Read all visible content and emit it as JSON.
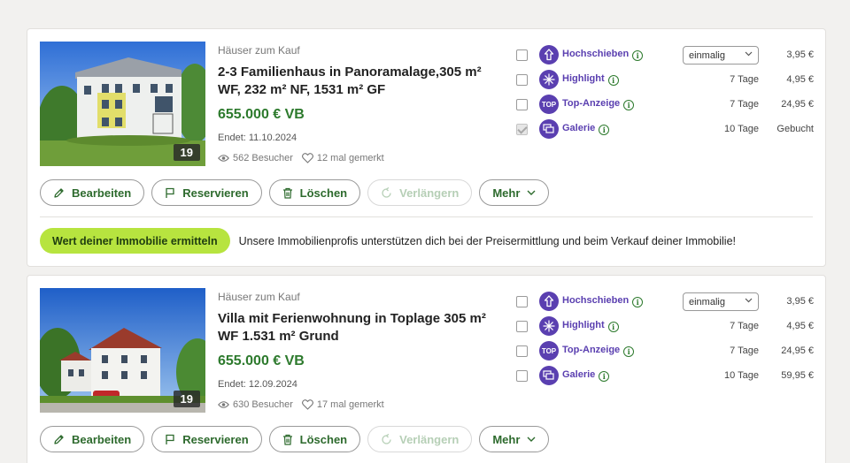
{
  "listings": [
    {
      "category": "Häuser zum Kauf",
      "title": "2-3 Familienhaus in Panoramalage,305 m² WF, 232 m² NF, 1531 m² GF",
      "price": "655.000 € VB",
      "ends": "Endet: 11.10.2024",
      "visitors": "562 Besucher",
      "saved": "12 mal gemerkt",
      "photo_count": "19",
      "options": [
        {
          "label": "Hochschieben",
          "select_value": "einmalig",
          "price": "3,95 €",
          "checked": false
        },
        {
          "label": "Highlight",
          "duration": "7 Tage",
          "price": "4,95 €",
          "checked": false
        },
        {
          "label": "Top-Anzeige",
          "duration": "7 Tage",
          "price": "24,95 €",
          "checked": false
        },
        {
          "label": "Galerie",
          "duration": "10 Tage",
          "price": "Gebucht",
          "checked": true
        }
      ],
      "promo": {
        "button": "Wert deiner Immobilie ermitteln",
        "text": "Unsere Immobilienprofis unterstützen dich bei der Preisermittlung und beim Verkauf deiner Immobilie!"
      }
    },
    {
      "category": "Häuser zum Kauf",
      "title": "Villa mit Ferienwohnung in Toplage 305 m² WF 1.531 m² Grund",
      "price": "655.000 € VB",
      "ends": "Endet: 12.09.2024",
      "visitors": "630 Besucher",
      "saved": "17 mal gemerkt",
      "photo_count": "19",
      "options": [
        {
          "label": "Hochschieben",
          "select_value": "einmalig",
          "price": "3,95 €",
          "checked": false
        },
        {
          "label": "Highlight",
          "duration": "7 Tage",
          "price": "4,95 €",
          "checked": false
        },
        {
          "label": "Top-Anzeige",
          "duration": "7 Tage",
          "price": "24,95 €",
          "checked": false
        },
        {
          "label": "Galerie",
          "duration": "10 Tage",
          "price": "59,95 €",
          "checked": false
        }
      ]
    }
  ],
  "top_icon_text": "TOP",
  "info_glyph": "i",
  "actions": {
    "edit": "Bearbeiten",
    "reserve": "Reservieren",
    "delete": "Löschen",
    "extend": "Verlängern",
    "more": "Mehr"
  }
}
